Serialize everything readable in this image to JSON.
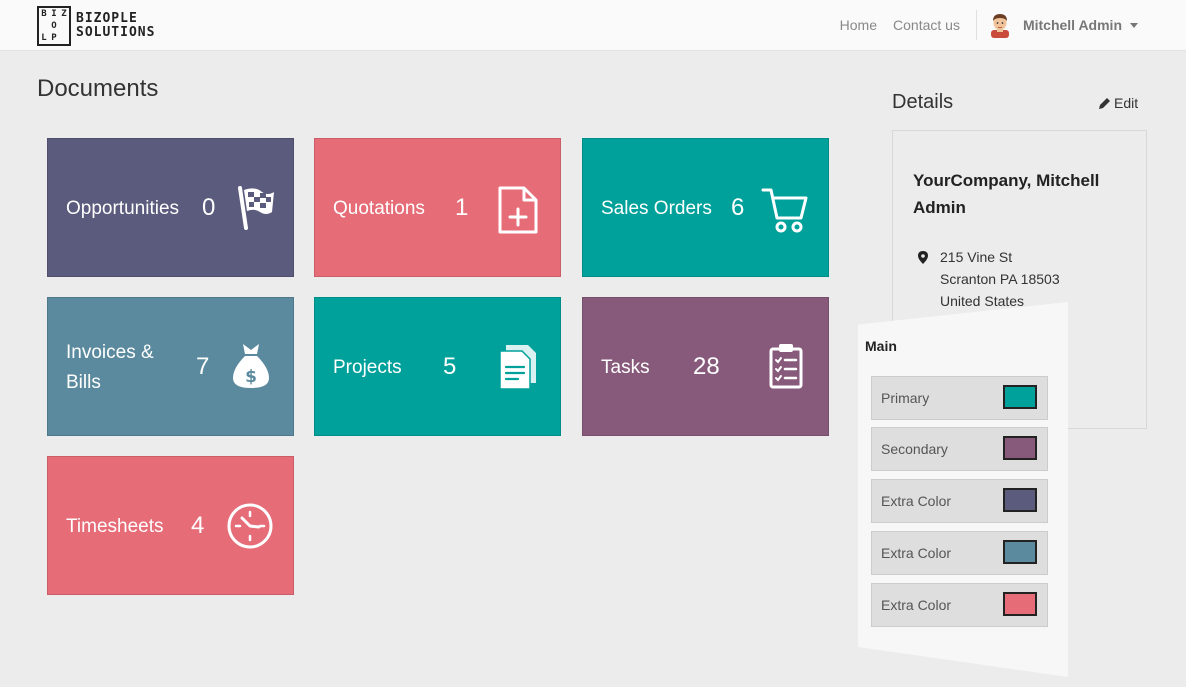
{
  "brand": {
    "logo_letters": [
      "B",
      "I",
      "Z",
      "",
      "O",
      "",
      "L",
      "P",
      ""
    ],
    "name_line1": "BIZOPLE",
    "name_line2": "SOLUTIONS"
  },
  "nav": {
    "home": "Home",
    "contact": "Contact us",
    "user": "Mitchell Admin"
  },
  "page": {
    "title": "Documents"
  },
  "tiles": [
    {
      "label": "Opportunities",
      "count": "0",
      "icon": "checkered-flag-icon",
      "color": "#5b5b7d"
    },
    {
      "label": "Quotations",
      "count": "1",
      "icon": "new-document-icon",
      "color": "#e66c77"
    },
    {
      "label": "Sales Orders",
      "count": "6",
      "icon": "shopping-cart-icon",
      "color": "#00a19a"
    },
    {
      "label": "Invoices &",
      "label2": "Bills",
      "count": "7",
      "icon": "money-bag-icon",
      "color": "#5b8a9e"
    },
    {
      "label": "Projects",
      "count": "5",
      "icon": "documents-icon",
      "color": "#00a19a"
    },
    {
      "label": "Tasks",
      "count": "28",
      "icon": "clipboard-checklist-icon",
      "color": "#875a7b"
    },
    {
      "label": "Timesheets",
      "count": "4",
      "icon": "clock-icon",
      "color": "#e66c77"
    }
  ],
  "details": {
    "title": "Details",
    "edit": "Edit",
    "company": "YourCompany, Mitchell Admin",
    "address": [
      "215 Vine St",
      "Scranton PA 18503",
      "United States"
    ]
  },
  "color_panel": {
    "title": "Main",
    "rows": [
      {
        "label": "Primary",
        "color": "#00a19a"
      },
      {
        "label": "Secondary",
        "color": "#875a7b"
      },
      {
        "label": "Extra Color",
        "color": "#5b5b7d"
      },
      {
        "label": "Extra Color",
        "color": "#5b8a9e"
      },
      {
        "label": "Extra Color",
        "color": "#e66c77"
      }
    ]
  }
}
